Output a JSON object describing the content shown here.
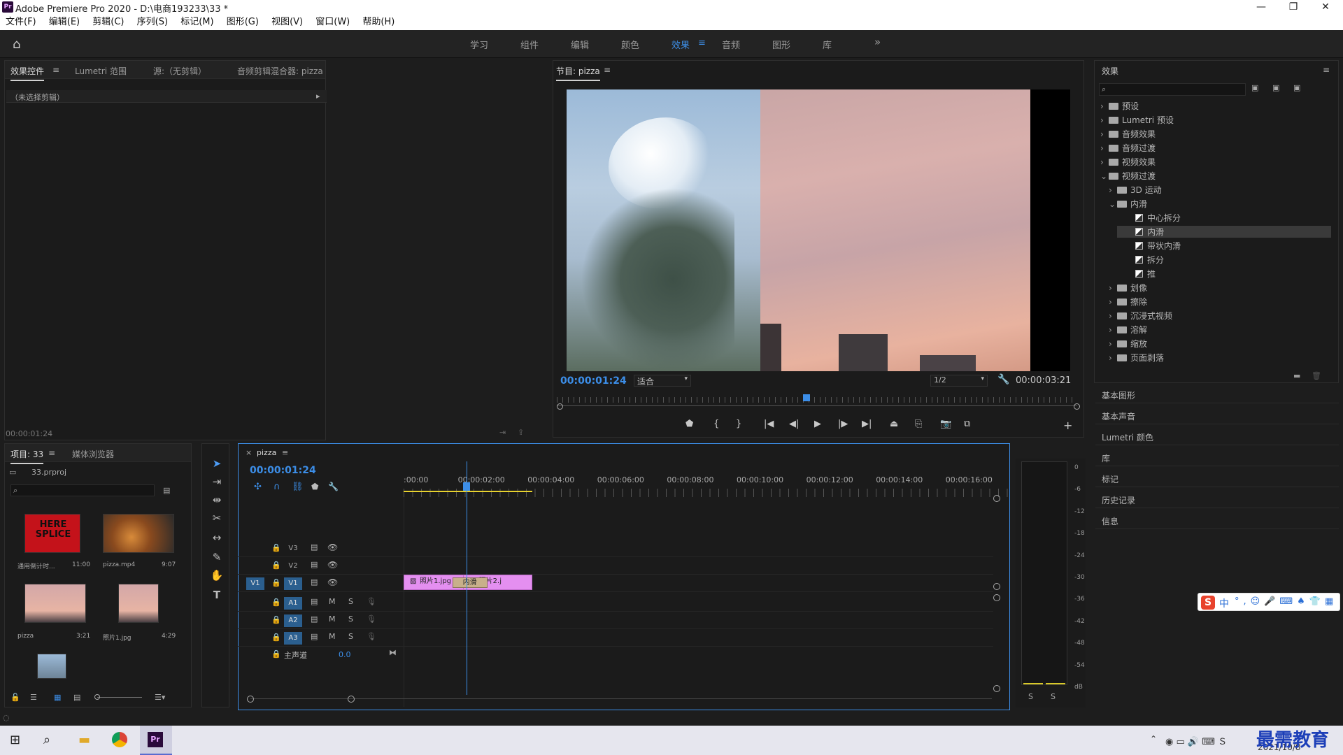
{
  "window": {
    "title": "Adobe Premiere Pro 2020 - D:\\电商193233\\33 *",
    "app_icon": "Pr",
    "controls": [
      "—",
      "❐",
      "✕"
    ]
  },
  "menu": [
    "文件(F)",
    "编辑(E)",
    "剪辑(C)",
    "序列(S)",
    "标记(M)",
    "图形(G)",
    "视图(V)",
    "窗口(W)",
    "帮助(H)"
  ],
  "workspaces": {
    "tabs": [
      "学习",
      "组件",
      "编辑",
      "颜色",
      "效果",
      "音频",
      "图形",
      "库"
    ],
    "active": "效果",
    "more": "»"
  },
  "effect_controls": {
    "tabs": [
      "效果控件",
      "Lumetri 范围",
      "源:（无剪辑）",
      "音频剪辑混合器: pizza"
    ],
    "no_clip": "（未选择剪辑）",
    "timecode": "00:00:01:24"
  },
  "program_monitor": {
    "title": "节目: pizza",
    "timecode_current": "00:00:01:24",
    "fit": "适合",
    "resolution": "1/2",
    "timecode_total": "00:00:03:21",
    "playhead_fraction": 0.48
  },
  "effects_panel": {
    "title": "效果",
    "search_placeholder": "",
    "tree": [
      {
        "label": "预设",
        "level": 0,
        "expanded": false,
        "kind": "folder"
      },
      {
        "label": "Lumetri 预设",
        "level": 0,
        "expanded": false,
        "kind": "folder"
      },
      {
        "label": "音频效果",
        "level": 0,
        "expanded": false,
        "kind": "folder"
      },
      {
        "label": "音频过渡",
        "level": 0,
        "expanded": false,
        "kind": "folder"
      },
      {
        "label": "视频效果",
        "level": 0,
        "expanded": false,
        "kind": "folder"
      },
      {
        "label": "视频过渡",
        "level": 0,
        "expanded": true,
        "kind": "folder"
      },
      {
        "label": "3D 运动",
        "level": 1,
        "expanded": false,
        "kind": "folder"
      },
      {
        "label": "内滑",
        "level": 1,
        "expanded": true,
        "kind": "folder"
      },
      {
        "label": "中心拆分",
        "level": 2,
        "kind": "fx"
      },
      {
        "label": "内滑",
        "level": 2,
        "kind": "fx",
        "selected": true
      },
      {
        "label": "带状内滑",
        "level": 2,
        "kind": "fx"
      },
      {
        "label": "拆分",
        "level": 2,
        "kind": "fx"
      },
      {
        "label": "推",
        "level": 2,
        "kind": "fx"
      },
      {
        "label": "划像",
        "level": 1,
        "expanded": false,
        "kind": "folder"
      },
      {
        "label": "擦除",
        "level": 1,
        "expanded": false,
        "kind": "folder"
      },
      {
        "label": "沉浸式视频",
        "level": 1,
        "expanded": false,
        "kind": "folder"
      },
      {
        "label": "溶解",
        "level": 1,
        "expanded": false,
        "kind": "folder"
      },
      {
        "label": "缩放",
        "level": 1,
        "expanded": false,
        "kind": "folder"
      },
      {
        "label": "页面剥落",
        "level": 1,
        "expanded": false,
        "kind": "folder"
      }
    ],
    "sections": [
      "基本图形",
      "基本声音",
      "Lumetri 颜色",
      "库",
      "标记",
      "历史记录",
      "信息"
    ]
  },
  "project_panel": {
    "tabs": [
      "项目: 33",
      "媒体浏览器"
    ],
    "project_file": "33.prproj",
    "items": [
      {
        "name": "通用倒计时...",
        "duration": "11:00",
        "badge": "HERE SPLICE"
      },
      {
        "name": "pizza.mp4",
        "duration": "9:07"
      },
      {
        "name": "pizza",
        "duration": "3:21"
      },
      {
        "name": "照片1.jpg",
        "duration": "4:29"
      }
    ]
  },
  "timeline": {
    "sequence": "pizza",
    "timecode": "00:00:01:24",
    "ruler": [
      ":00:00",
      "00:00:02:00",
      "00:00:04:00",
      "00:00:06:00",
      "00:00:08:00",
      "00:00:10:00",
      "00:00:12:00",
      "00:00:14:00",
      "00:00:16:00"
    ],
    "video_tracks": [
      "V3",
      "V2",
      "V1"
    ],
    "audio_tracks": [
      "A1",
      "A2",
      "A3"
    ],
    "source_patch": "V1",
    "mix_label": "主声道",
    "mix_value": "0.0",
    "clips": [
      {
        "name": "照片1.jpg",
        "start_sec": 0,
        "end_sec": 2.0
      },
      {
        "name": "照片2.j",
        "start_sec": 1.7,
        "end_sec": 3.7
      }
    ],
    "transition": {
      "name": "内滑",
      "start_sec": 1.4,
      "end_sec": 2.4
    },
    "track_buttons": {
      "mute": "M",
      "solo": "S"
    },
    "playhead_sec": 1.8
  },
  "audio_meter": {
    "scale": [
      "0",
      "-6",
      "-12",
      "-18",
      "-24",
      "-30",
      "-36",
      "-42",
      "-48",
      "-54",
      "dB"
    ],
    "solo": [
      "S",
      "S"
    ]
  },
  "taskbar": {
    "date": "2021/10/8",
    "watermark": "最需教育",
    "ime": "中"
  }
}
